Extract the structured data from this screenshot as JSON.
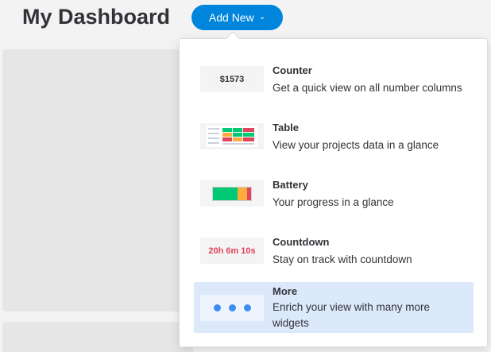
{
  "header": {
    "title": "My Dashboard",
    "add_new_label": "Add New"
  },
  "colors": {
    "accent": "#0085dc",
    "highlight": "#dbe9fb",
    "battery_green": "#00c875",
    "battery_orange": "#fdab3d",
    "battery_red": "#e2445c",
    "countdown_red": "#e2445c",
    "more_dots": "#3d8ef2"
  },
  "widgets": [
    {
      "title": "Counter",
      "description": "Get a quick view on all number columns",
      "thumb_text": "$1573",
      "icon": "counter-thumbnail"
    },
    {
      "title": "Table",
      "description": "View your projects data in a glance",
      "icon": "table-thumbnail"
    },
    {
      "title": "Battery",
      "description": "Your progress in a glance",
      "icon": "battery-thumbnail"
    },
    {
      "title": "Countdown",
      "description": "Stay on track with countdown",
      "thumb_text": "20h 6m 10s",
      "icon": "countdown-thumbnail"
    },
    {
      "title": "More",
      "description": "Enrich your view with many more widgets",
      "icon": "more-dots-thumbnail",
      "highlighted": true
    }
  ]
}
